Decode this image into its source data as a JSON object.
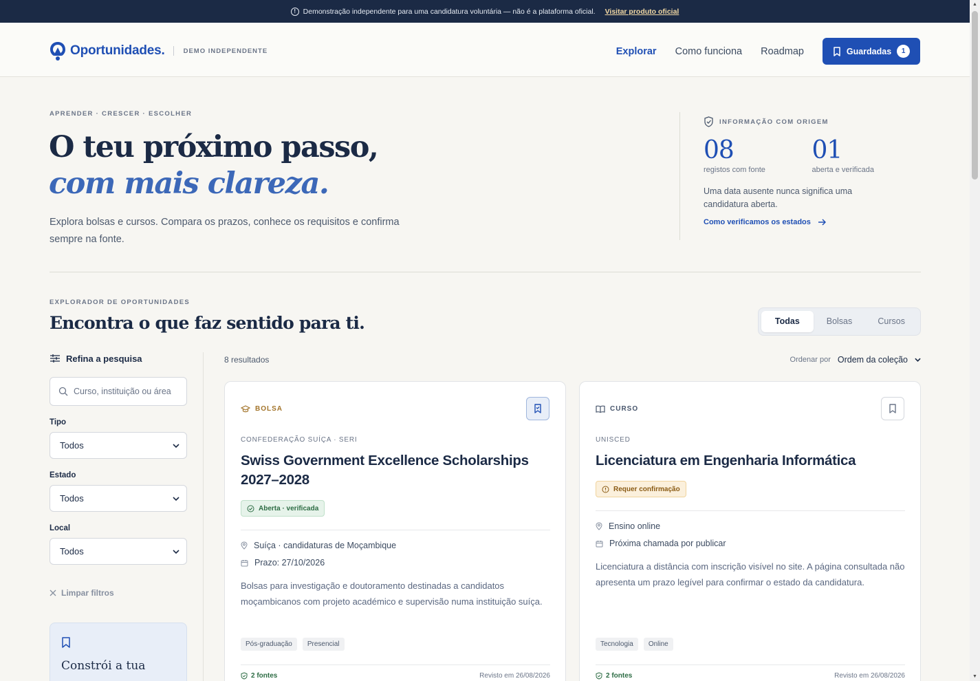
{
  "banner": {
    "text": "Demonstração independente para uma candidatura voluntária — não é a plataforma oficial.",
    "link": "Visitar produto oficial"
  },
  "header": {
    "logo": "Oportunidades.",
    "tag": "DEMO INDEPENDENTE",
    "nav": [
      "Explorar",
      "Como funciona",
      "Roadmap"
    ],
    "saved_label": "Guardadas",
    "saved_count": "1"
  },
  "hero": {
    "eyebrow": "APRENDER · CRESCER · ESCOLHER",
    "title_line1": "O teu próximo passo,",
    "title_line2": "com mais clareza.",
    "subtitle": "Explora bolsas e cursos. Compara os prazos, conhece os requisitos e confirma sempre na fonte."
  },
  "stats": {
    "heading": "INFORMAÇÃO COM ORIGEM",
    "items": [
      {
        "value": "08",
        "label": "registos com fonte"
      },
      {
        "value": "01",
        "label": "aberta e verificada"
      }
    ],
    "note": "Uma data ausente nunca significa uma candidatura aberta.",
    "link": "Como verificamos os estados"
  },
  "explorer": {
    "eyebrow": "EXPLORADOR DE OPORTUNIDADES",
    "title": "Encontra o que faz sentido para ti.",
    "tabs": [
      "Todas",
      "Bolsas",
      "Cursos"
    ],
    "active_tab": "Todas"
  },
  "filters": {
    "title": "Refina a pesquisa",
    "search_placeholder": "Curso, instituição ou área",
    "type_label": "Tipo",
    "type_value": "Todos",
    "status_label": "Estado",
    "status_value": "Todos",
    "location_label": "Local",
    "location_value": "Todos",
    "clear": "Limpar filtros",
    "promo_title": "Constrói a tua"
  },
  "results": {
    "count": "8 resultados",
    "sort_label": "Ordenar por",
    "sort_value": "Ordem da coleção"
  },
  "cards": [
    {
      "type": "BOLSA",
      "institution": "CONFEDERAÇÃO SUÍÇA · SERI",
      "title": "Swiss Government Excellence Scholarships 2027–2028",
      "status": "Aberta · verificada",
      "location": "Suíça · candidaturas de Moçambique",
      "deadline": "Prazo: 27/10/2026",
      "description": "Bolsas para investigação e doutoramento destinadas a candidatos moçambicanos com projeto académico e supervisão numa instituição suíça.",
      "tags": [
        "Pós-graduação",
        "Presencial"
      ],
      "sources": "2 fontes",
      "revised": "Revisto em 26/08/2026",
      "saved": true
    },
    {
      "type": "CURSO",
      "institution": "UNISCED",
      "title": "Licenciatura em Engenharia Informática",
      "status": "Requer confirmação",
      "location": "Ensino online",
      "deadline": "Próxima chamada por publicar",
      "description": "Licenciatura a distância com inscrição visível no site. A página consultada não apresenta um prazo legível para confirmar o estado da candidatura.",
      "tags": [
        "Tecnologia",
        "Online"
      ],
      "sources": "2 fontes",
      "revised": "Revisto em 26/08/2026",
      "saved": false
    }
  ],
  "colors": {
    "brand": "#1f4fb4",
    "banner_bg": "#1b2a45",
    "accent_italic": "#3c68b8",
    "status_ok": "#2d6c44",
    "status_warn": "#8a5b14",
    "bolsa": "#a3742a"
  }
}
